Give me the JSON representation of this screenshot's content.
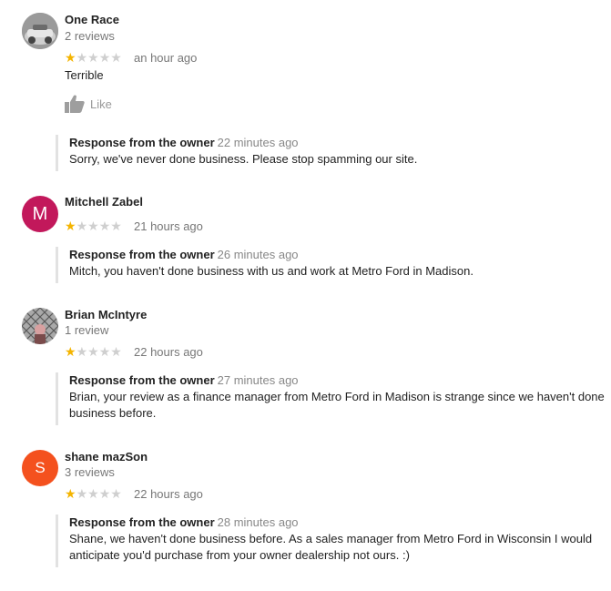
{
  "reviews": [
    {
      "name": "One Race",
      "subtitle": "2 reviews",
      "rating": 1,
      "time": "an hour ago",
      "text": "Terrible",
      "like_label": "Like",
      "response": {
        "title": "Response from the owner",
        "time": "22 minutes ago",
        "text": "Sorry, we've never done business. Please stop spamming our site."
      }
    },
    {
      "name": "Mitchell Zabel",
      "avatar_letter": "M",
      "avatar_color": "#c2185b",
      "rating": 1,
      "time": "21 hours ago",
      "response": {
        "title": "Response from the owner",
        "time": "26 minutes ago",
        "text": "Mitch, you haven't done business with us and work at Metro Ford in Madison."
      }
    },
    {
      "name": "Brian McIntyre",
      "subtitle": "1 review",
      "rating": 1,
      "time": "22 hours ago",
      "response": {
        "title": "Response from the owner",
        "time": "27 minutes ago",
        "text_line1": "Brian, your review as a finance manager from Metro Ford in Madison is strange since we haven't done",
        "text_line2": "business before."
      }
    },
    {
      "name": "shane mazSon",
      "subtitle": "3 reviews",
      "avatar_letter": "S",
      "avatar_color": "#f4511e",
      "rating": 1,
      "time": "22 hours ago",
      "response": {
        "title": "Response from the owner",
        "time": "28 minutes ago",
        "text_line1": "Shane, we haven't done business before. As a sales manager from Metro Ford in Wisconsin I would",
        "text_line2": "anticipate you'd purchase from your owner dealership not ours. :)"
      }
    }
  ],
  "colors": {
    "star_on": "#f4b400",
    "star_off": "#cfcfcf",
    "response_bar": "#e2e2e2"
  },
  "icons": {
    "like": "thumbs-up-icon",
    "star": "star-icon"
  }
}
